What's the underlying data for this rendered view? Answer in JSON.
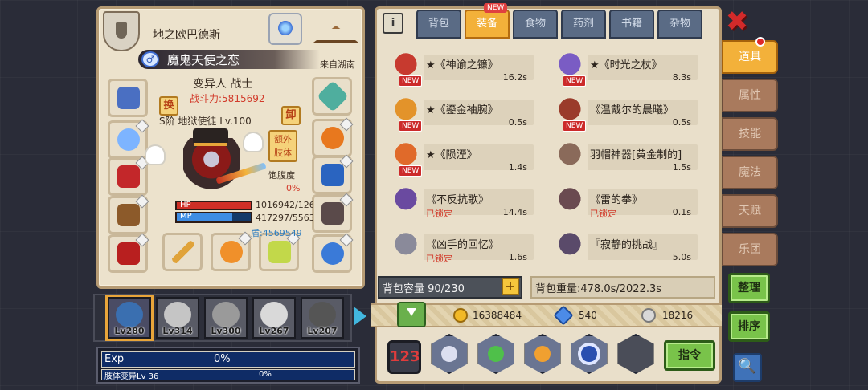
{
  "character": {
    "player_name": "地之欧巴德斯",
    "title": "魔鬼天使之恋",
    "origin": "来自湖南",
    "class_line": "变异人 战士",
    "power": "战斗力:5815692",
    "rank": "S阶 地狱使徒 Lv.100",
    "swap_label": "换",
    "unload_label": "卸",
    "extra_limb_label": "额外肢体",
    "satiety_label": "饱腹度",
    "satiety_value": "0%",
    "hp_label": "HP",
    "mp_label": "MP",
    "hp_text": "1016942/126",
    "mp_text": "417297/5563",
    "shield_text": "盾:4569549",
    "hp_fraction": 1.0,
    "mp_fraction": 0.75
  },
  "team": [
    {
      "level": "Lv280",
      "active": true,
      "color": "#3a6fb0"
    },
    {
      "level": "Lv314",
      "active": false,
      "color": "#c5c5c5"
    },
    {
      "level": "Lv300",
      "active": false,
      "color": "#9a9a9a"
    },
    {
      "level": "Lv267",
      "active": false,
      "color": "#d9d9d9"
    },
    {
      "level": "Lv207",
      "active": false,
      "color": "#555555"
    }
  ],
  "exp": {
    "label": "Exp",
    "percent": "0%",
    "limb_label": "肢体变异Lv 36",
    "limb_percent": "0%"
  },
  "inventory": {
    "tabs": [
      "背包",
      "装备",
      "食物",
      "药剂",
      "书籍",
      "杂物"
    ],
    "active_tab": "装备",
    "new_badge": "NEW",
    "items": [
      {
        "name": "★《神谕之镰》",
        "weight": "16.2s",
        "new": true,
        "locked": "",
        "color": "#c73a2f"
      },
      {
        "name": "★《时光之杖》",
        "weight": "8.3s",
        "new": true,
        "locked": "",
        "color": "#7a5cc4"
      },
      {
        "name": "★《鎏金袖腕》",
        "weight": "0.5s",
        "new": true,
        "locked": "",
        "color": "#e3932a"
      },
      {
        "name": "《温戴尔的晨曦》",
        "weight": "0.5s",
        "new": true,
        "locked": "",
        "color": "#9a3b2a"
      },
      {
        "name": "★《陨湮》",
        "weight": "1.4s",
        "new": true,
        "locked": "",
        "color": "#e06a2a"
      },
      {
        "name": "羽帽神器[黄金制的]",
        "weight": "1.5s",
        "new": false,
        "locked": "",
        "color": "#8a6a5a"
      },
      {
        "name": "《不反抗歌》",
        "weight": "14.4s",
        "new": false,
        "locked": "已锁定",
        "color": "#6a4aa0"
      },
      {
        "name": "《雷的拳》",
        "weight": "0.1s",
        "new": false,
        "locked": "已锁定",
        "color": "#6a4a50"
      },
      {
        "name": "《凶手的回忆》",
        "weight": "1.6s",
        "new": false,
        "locked": "已锁定",
        "color": "#8a8a9a"
      },
      {
        "name": "『寂静的挑战』",
        "weight": "5.0s",
        "new": false,
        "locked": "",
        "color": "#5a4a6a"
      }
    ],
    "capacity": "背包容量 90/230",
    "weight": "背包重量:478.0s/2022.3s"
  },
  "currency": {
    "gold": "16388484",
    "diamond": "540",
    "silver": "18216"
  },
  "actions": {
    "combo_label": "123",
    "command_label": "指令"
  },
  "side_tabs": [
    "道具",
    "属性",
    "技能",
    "魔法",
    "天赋",
    "乐团"
  ],
  "side_actions": {
    "organize": "整理",
    "sort": "排序",
    "close": "✖",
    "search": "🔍"
  }
}
